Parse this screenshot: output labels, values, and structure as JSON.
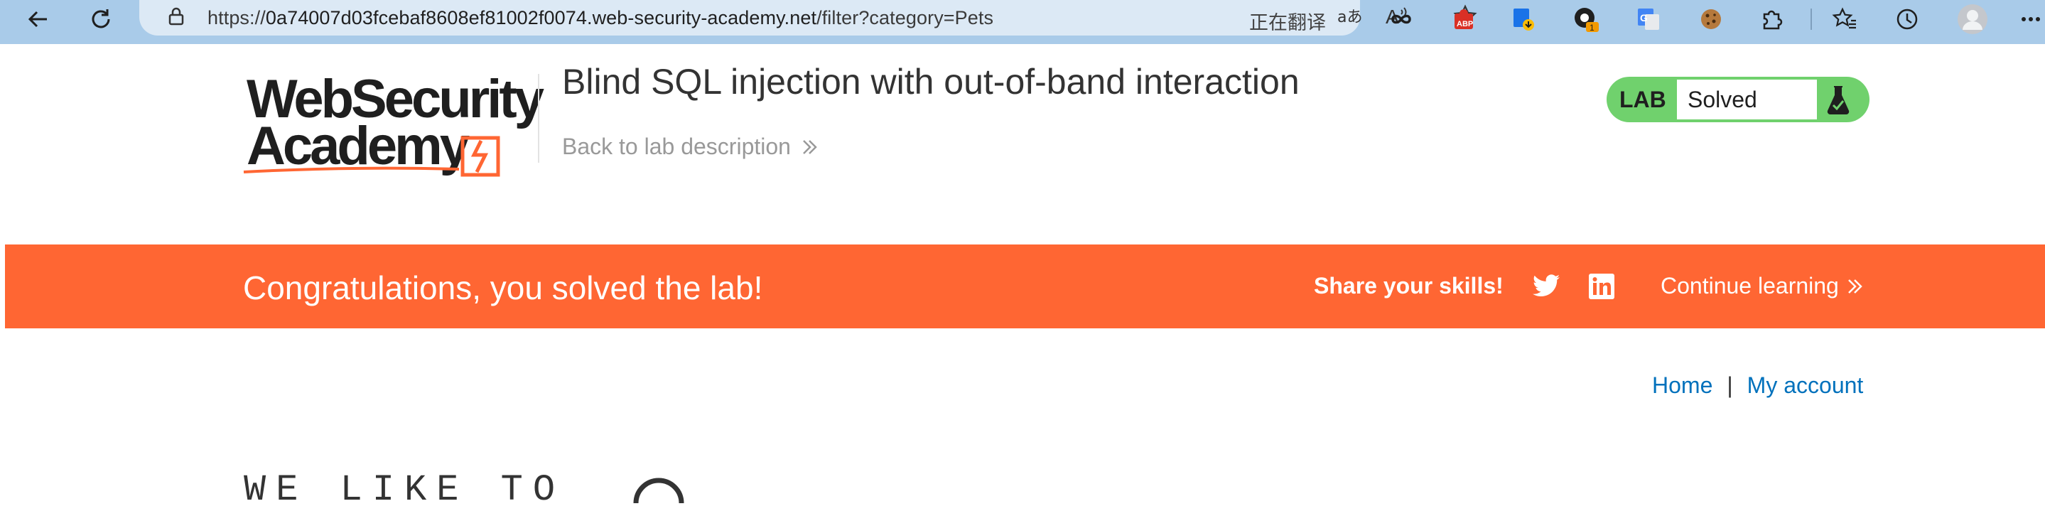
{
  "browser": {
    "url_prefix": "https://",
    "url_host": "0a74007d03fcebaf8608ef81002f0074.web-security-academy.net",
    "url_path": "/filter?category=Pets",
    "translate_status": "正在翻译",
    "extension_badge_count": "1",
    "icons": [
      "back-arrow-icon",
      "reload-icon",
      "site-info-icon",
      "translate-icon",
      "read-aloud-icon",
      "favorite-star-icon",
      "infinity-extension-icon",
      "adblock-extension-icon",
      "download-extension-icon",
      "notification-extension-icon",
      "google-translate-extension-icon",
      "cookie-extension-icon",
      "extensions-puzzle-icon",
      "favorites-icon",
      "history-icon",
      "profile-avatar-icon",
      "more-icon"
    ]
  },
  "header": {
    "logo_line1": "WebSecurity",
    "logo_line2": "Academy",
    "title": "Blind SQL injection with out-of-band interaction",
    "back_link": "Back to lab description",
    "lab_label": "LAB",
    "lab_status": "Solved"
  },
  "banner": {
    "message": "Congratulations, you solved the lab!",
    "share_label": "Share your skills!",
    "continue_label": "Continue learning",
    "color": "#ff6633"
  },
  "nav": {
    "home": "Home",
    "separator": "|",
    "account": "My account"
  },
  "hero": {
    "text": "WE LIKE TO"
  },
  "colors": {
    "brand_orange": "#ff6633",
    "solved_green": "#70d16d",
    "link_blue": "#0071bc",
    "toolbar_blue": "#a9cbe9"
  }
}
